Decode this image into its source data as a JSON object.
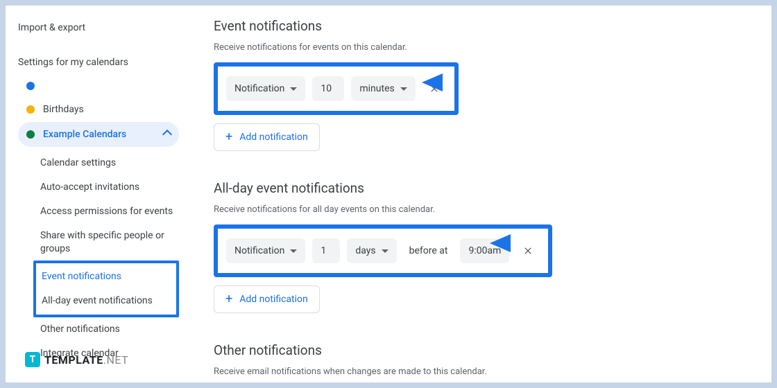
{
  "sidebar": {
    "import_export": "Import & export",
    "section_title": "Settings for my calendars",
    "calendars": [
      {
        "label": "",
        "color": "#1a73e8"
      },
      {
        "label": "Birthdays",
        "color": "#f4b400"
      },
      {
        "label": "Example Calendars",
        "color": "#0b8043",
        "active": true
      }
    ],
    "subitems": [
      "Calendar settings",
      "Auto-accept invitations",
      "Access permissions for events",
      "Share with specific people or groups",
      "Event notifications",
      "All-day event notifications",
      "Other notifications",
      "Integrate calendar"
    ]
  },
  "main": {
    "event_notifications": {
      "title": "Event notifications",
      "desc": "Receive notifications for events on this calendar.",
      "type": "Notification",
      "value": "10",
      "unit": "minutes",
      "add": "Add notification"
    },
    "allday": {
      "title": "All-day event notifications",
      "desc": "Receive notifications for all day events on this calendar.",
      "type": "Notification",
      "value": "1",
      "unit": "days",
      "before": "before at",
      "time": "9:00am",
      "add": "Add notification"
    },
    "other": {
      "title": "Other notifications",
      "desc": "Receive email notifications when changes are made to this calendar."
    }
  },
  "watermark": {
    "brand": "TEMPLATE",
    "suffix": ".NET",
    "logo": "T"
  }
}
